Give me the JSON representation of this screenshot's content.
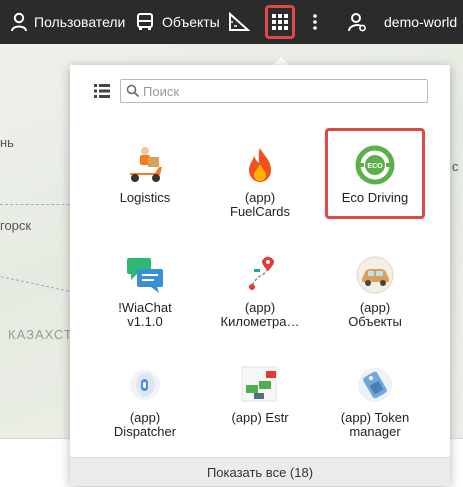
{
  "topbar": {
    "users_label": "Пользователи",
    "objects_label": "Объекты",
    "account_label": "demo-world"
  },
  "map": {
    "labels": [
      "нь",
      "горск",
      "КАЗАХСТ"
    ]
  },
  "apps_panel": {
    "search_placeholder": "Поиск",
    "apps": [
      {
        "label": "Logistics",
        "icon": "delivery-scooter-icon"
      },
      {
        "label": "(app)\nFuelCards",
        "icon": "flame-icon"
      },
      {
        "label": "Eco Driving",
        "icon": "eco-steering-wheel-icon"
      },
      {
        "label": "!WiaChat\nv1.1.0",
        "icon": "chat-bubbles-icon"
      },
      {
        "label": "(app)\nКилометра…",
        "icon": "route-pins-icon"
      },
      {
        "label": "(app)\nОбъекты",
        "icon": "car-icon"
      },
      {
        "label": "(app)\nDispatcher",
        "icon": "dispatcher-icon"
      },
      {
        "label": "(app) Estr",
        "icon": "estr-flags-icon"
      },
      {
        "label": "(app) Token\nmanager",
        "icon": "token-tag-icon"
      }
    ],
    "footer_label": "Показать все (18)"
  },
  "colors": {
    "topbar_bg": "#2b2b2b",
    "highlight": "#e04848",
    "eco_green": "#5bb04a"
  }
}
